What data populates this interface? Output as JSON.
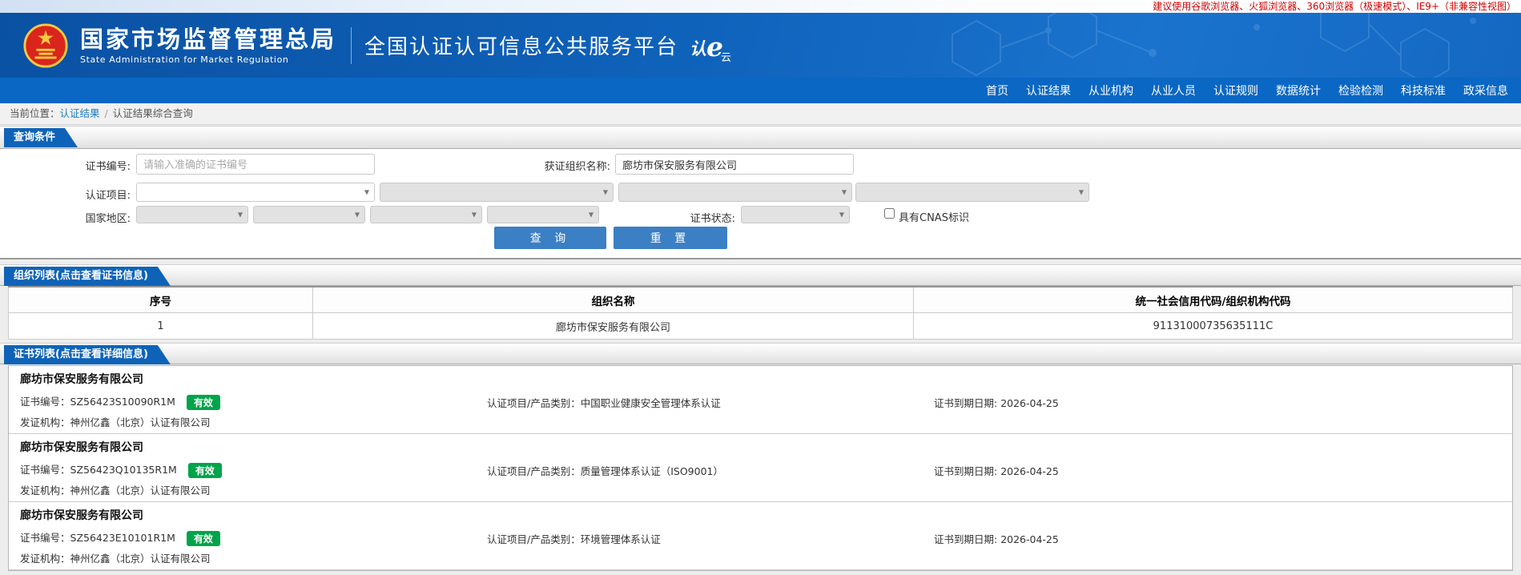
{
  "notice": {
    "text": "建议使用谷歌浏览器、火狐浏览器、360浏览器（极速模式）、IE9+（非兼容性视图）"
  },
  "header": {
    "org_cn": "国家市场监督管理总局",
    "org_en": "State Administration  for  Market Regulation",
    "platform": "全国认证认可信息公共服务平台",
    "logo": {
      "p1": "认",
      "p2": "e",
      "p3": "云"
    }
  },
  "nav": {
    "items": [
      "首页",
      "认证结果",
      "从业机构",
      "从业人员",
      "认证规则",
      "数据统计",
      "检验检测",
      "科技标准",
      "政采信息"
    ]
  },
  "breadcrumb": {
    "prefix": "当前位置：",
    "link": "认证结果",
    "separator": "/",
    "current": "认证结果综合查询"
  },
  "query": {
    "section_title": "查询条件",
    "cert_no_label": "证书编号:",
    "cert_no_placeholder": "请输入准确的证书编号",
    "org_name_label": "获证组织名称:",
    "org_name_value": "廊坊市保安服务有限公司",
    "project_label": "认证项目:",
    "region_label": "国家地区:",
    "status_label": "证书状态:",
    "cnas_label": "具有CNAS标识",
    "search_btn": "查 询",
    "reset_btn": "重 置"
  },
  "org_list": {
    "section_title": "组织列表(点击查看证书信息)",
    "columns": [
      "序号",
      "组织名称",
      "统一社会信用代码/组织机构代码"
    ],
    "rows": [
      {
        "index": "1",
        "name": "廊坊市保安服务有限公司",
        "code": "91131000735635111C"
      }
    ]
  },
  "cert_list": {
    "section_title": "证书列表(点击查看详细信息)",
    "labels": {
      "cert_no": "证书编号：",
      "project": "认证项目/产品类别：",
      "expiry": "证书到期日期: ",
      "issuer": "发证机构："
    },
    "cards": [
      {
        "org": "廊坊市保安服务有限公司",
        "cert_no": "SZ56423S10090R1M",
        "status": "有效",
        "project": "中国职业健康安全管理体系认证",
        "expiry": "2026-04-25",
        "issuer": "神州亿鑫（北京）认证有限公司"
      },
      {
        "org": "廊坊市保安服务有限公司",
        "cert_no": "SZ56423Q10135R1M",
        "status": "有效",
        "project": "质量管理体系认证（ISO9001）",
        "expiry": "2026-04-25",
        "issuer": "神州亿鑫（北京）认证有限公司"
      },
      {
        "org": "廊坊市保安服务有限公司",
        "cert_no": "SZ56423E10101R1M",
        "status": "有效",
        "project": "环境管理体系认证",
        "expiry": "2026-04-25",
        "issuer": "神州亿鑫（北京）认证有限公司"
      }
    ]
  },
  "icons": {
    "chevron_down": "▼"
  },
  "colors": {
    "header_blue": "#0f62ba",
    "nav_blue": "#0a67c4",
    "tab_blue": "#0e63b8",
    "button_blue": "#3b7fc4",
    "link_blue": "#1b7ec2",
    "badge_green": "#00a44a",
    "notice_red": "#d30000"
  }
}
